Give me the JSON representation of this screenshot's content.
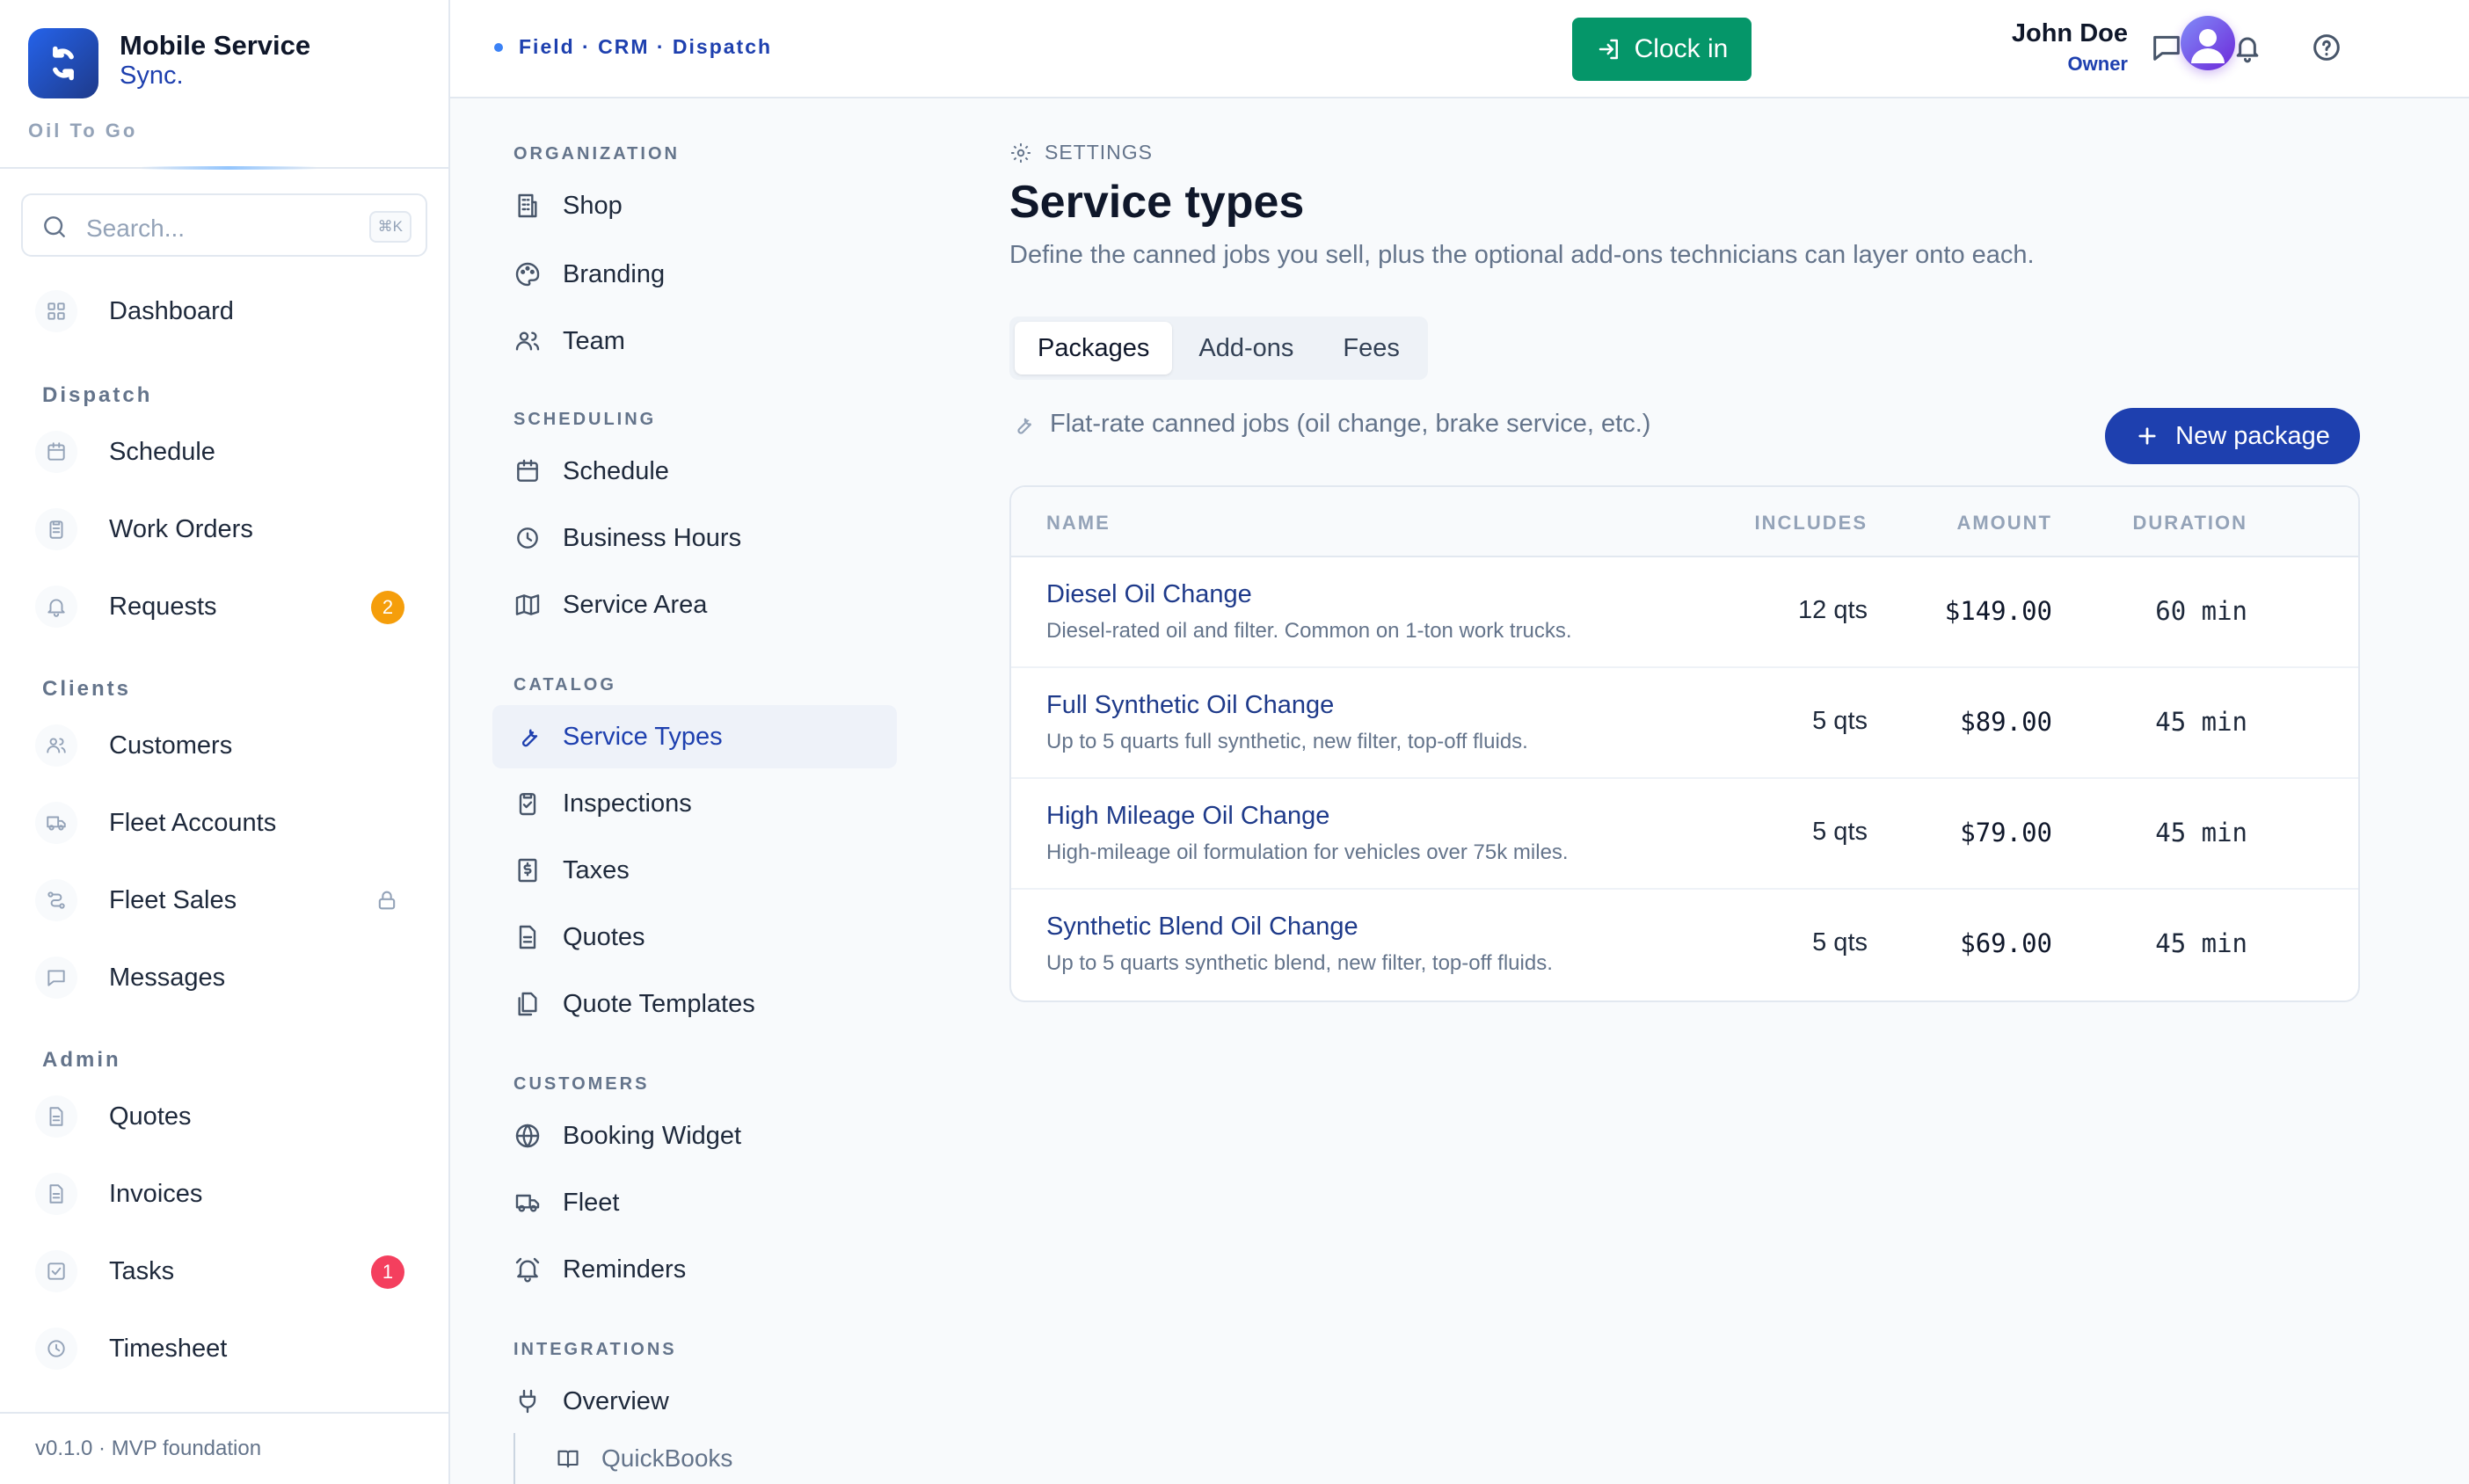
{
  "brand": {
    "name": "Mobile Service",
    "sub": "Sync.",
    "org": "Oil To Go"
  },
  "search": {
    "placeholder": "Search...",
    "shortcut": "⌘K"
  },
  "sidebar": {
    "top": [
      {
        "label": "Dashboard",
        "icon": "grid-icon"
      }
    ],
    "sections": [
      {
        "title": "Dispatch",
        "items": [
          {
            "label": "Schedule",
            "icon": "calendar-icon"
          },
          {
            "label": "Work Orders",
            "icon": "clipboard-icon"
          },
          {
            "label": "Requests",
            "icon": "bell-icon",
            "badge": "2"
          }
        ]
      },
      {
        "title": "Clients",
        "items": [
          {
            "label": "Customers",
            "icon": "users-icon"
          },
          {
            "label": "Fleet Accounts",
            "icon": "truck-icon"
          },
          {
            "label": "Fleet Sales",
            "icon": "route-icon"
          },
          {
            "label": "Messages",
            "icon": "message-icon"
          }
        ]
      },
      {
        "title": "Admin",
        "items": [
          {
            "label": "Quotes",
            "icon": "file-icon"
          },
          {
            "label": "Invoices",
            "icon": "file-icon"
          },
          {
            "label": "Tasks",
            "icon": "checkbox-icon",
            "badge": "1"
          },
          {
            "label": "Timesheet",
            "icon": "clock-icon"
          }
        ]
      }
    ],
    "version": "v0.1.0 · MVP foundation"
  },
  "topbar": {
    "crumb": "Field · CRM · Dispatch",
    "clock_in": "Clock in",
    "user_name": "John Doe",
    "user_role": "Owner"
  },
  "subnav": {
    "sections": [
      {
        "title": "ORGANIZATION",
        "items": [
          "Shop",
          "Branding",
          "Team"
        ]
      },
      {
        "title": "SCHEDULING",
        "items": [
          "Schedule",
          "Business Hours",
          "Service Area"
        ]
      },
      {
        "title": "CATALOG",
        "items": [
          "Service Types",
          "Inspections",
          "Taxes",
          "Quotes",
          "Quote Templates"
        ]
      },
      {
        "title": "CUSTOMERS",
        "items": [
          "Booking Widget",
          "Fleet",
          "Reminders"
        ]
      },
      {
        "title": "INTEGRATIONS",
        "items": [
          "Overview"
        ]
      }
    ],
    "child": "QuickBooks",
    "active": "Service Types"
  },
  "main": {
    "eyebrow": "SETTINGS",
    "title": "Service types",
    "description": "Define the canned jobs you sell, plus the optional add-ons technicians can layer onto each.",
    "tabs": [
      "Packages",
      "Add-ons",
      "Fees"
    ],
    "active_tab": "Packages",
    "hint": "Flat-rate canned jobs (oil change, brake service, etc.)",
    "new_button": "New package",
    "table": {
      "headers": {
        "name": "NAME",
        "includes": "INCLUDES",
        "amount": "AMOUNT",
        "duration": "DURATION"
      },
      "rows": [
        {
          "name": "Diesel Oil Change",
          "desc": "Diesel-rated oil and filter. Common on 1-ton work trucks.",
          "includes": "12 qts",
          "amount": "$149.00",
          "duration": "60 min"
        },
        {
          "name": "Full Synthetic Oil Change",
          "desc": "Up to 5 quarts full synthetic, new filter, top-off fluids.",
          "includes": "5 qts",
          "amount": "$89.00",
          "duration": "45 min"
        },
        {
          "name": "High Mileage Oil Change",
          "desc": "High-mileage oil formulation for vehicles over 75k miles.",
          "includes": "5 qts",
          "amount": "$79.00",
          "duration": "45 min"
        },
        {
          "name": "Synthetic Blend Oil Change",
          "desc": "Up to 5 quarts synthetic blend, new filter, top-off fluids.",
          "includes": "5 qts",
          "amount": "$69.00",
          "duration": "45 min"
        }
      ]
    }
  },
  "colors": {
    "accent": "#1e40af",
    "success": "#059669",
    "warning": "#f59e0b",
    "danger": "#f43f5e"
  }
}
